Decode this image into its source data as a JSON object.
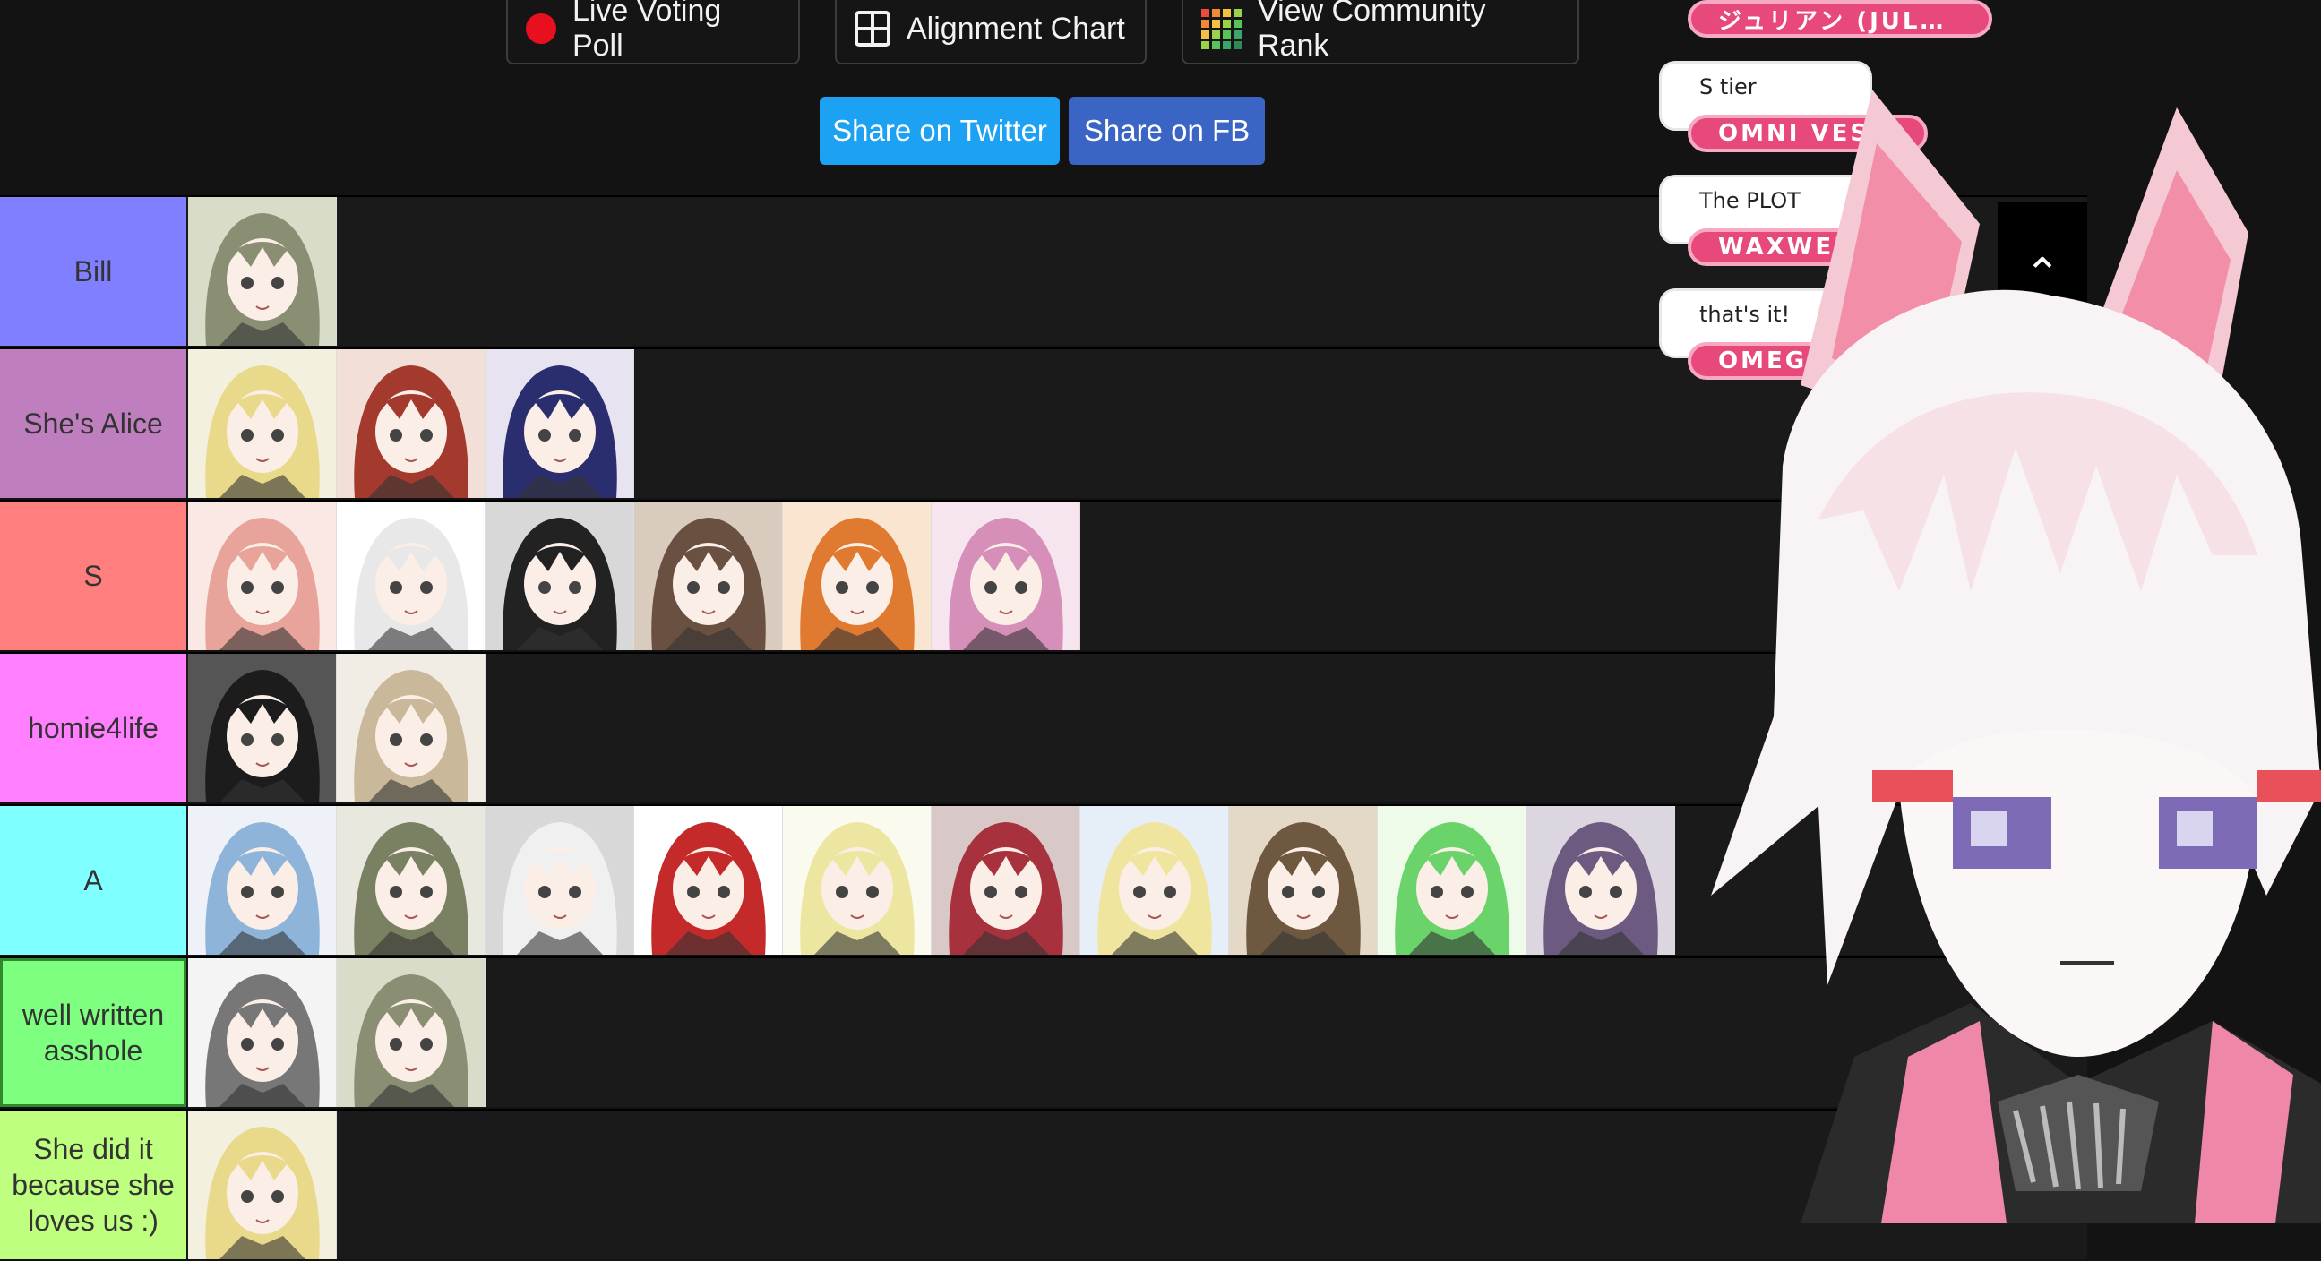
{
  "toolbar": {
    "live_voting": {
      "label": "Live Voting Poll",
      "icon": "record-dot-icon"
    },
    "alignment": {
      "label": "Alignment Chart",
      "icon": "grid-icon"
    },
    "community_rank": {
      "label": "View Community Rank",
      "icon": "color-grid-icon"
    }
  },
  "share": {
    "twitter": {
      "label": "Share on Twitter",
      "color": "#1da1f2"
    },
    "facebook": {
      "label": "Share on FB",
      "color": "#3b65c4"
    }
  },
  "tiers": [
    {
      "label": "Bill",
      "color": "#7f7fff",
      "count": 1
    },
    {
      "label": "She's Alice",
      "color": "#bf7fbf",
      "count": 3
    },
    {
      "label": "S",
      "color": "#ff7f7f",
      "count": 6
    },
    {
      "label": "homie4life",
      "color": "#ff7fff",
      "count": 2
    },
    {
      "label": "A",
      "color": "#7fffff",
      "count": 10
    },
    {
      "label": "well written asshole",
      "color": "#7fff7f",
      "count": 2
    },
    {
      "label": "She did it because she loves us :)",
      "color": "#bfff7f",
      "count": 1
    }
  ],
  "chat": [
    {
      "message": "",
      "name": "ジュリアン (JUL…"
    },
    {
      "message": "S tier",
      "name": "OMNI VESPA"
    },
    {
      "message": "The PLOT",
      "name": "WAXWELL"
    },
    {
      "message": "that's it!",
      "name": "OMEGA 2"
    }
  ],
  "collapse_icon": "chevron-up-icon"
}
